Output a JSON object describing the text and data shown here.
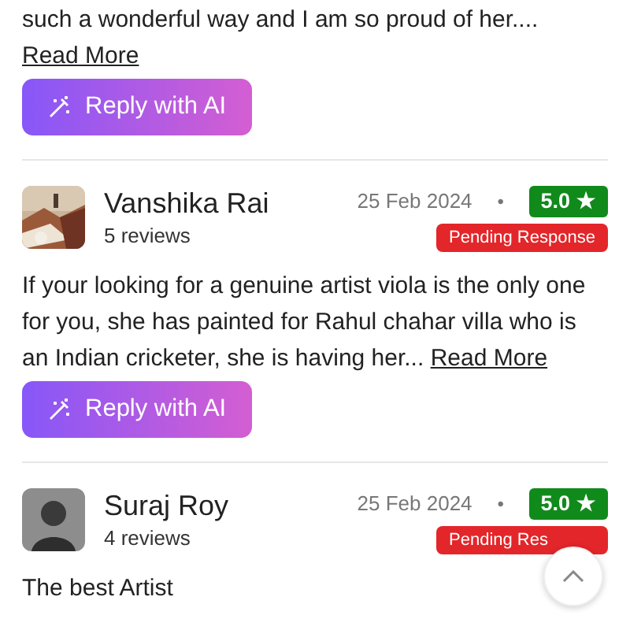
{
  "reviews": [
    {
      "text": "such a wonderful way and I am so proud of her....",
      "read_more": "Read More",
      "reply_button": "Reply with AI"
    },
    {
      "name": "Vanshika Rai",
      "review_count": "5 reviews",
      "date": "25 Feb 2024",
      "separator": "•",
      "rating": "5.0 ★",
      "status": "Pending Response",
      "text": "If your looking for a genuine artist viola is the only one for you, she has painted for Rahul chahar villa who is an Indian cricketer, she is having her...",
      "read_more": "Read More",
      "reply_button": "Reply with AI"
    },
    {
      "avatar": {
        "kind": "person"
      },
      "name": "Suraj Roy",
      "review_count": "4 reviews",
      "date": "25 Feb 2024",
      "separator": "•",
      "rating": "5.0 ★",
      "status": "Pending Res",
      "text": "The best Artist"
    }
  ]
}
